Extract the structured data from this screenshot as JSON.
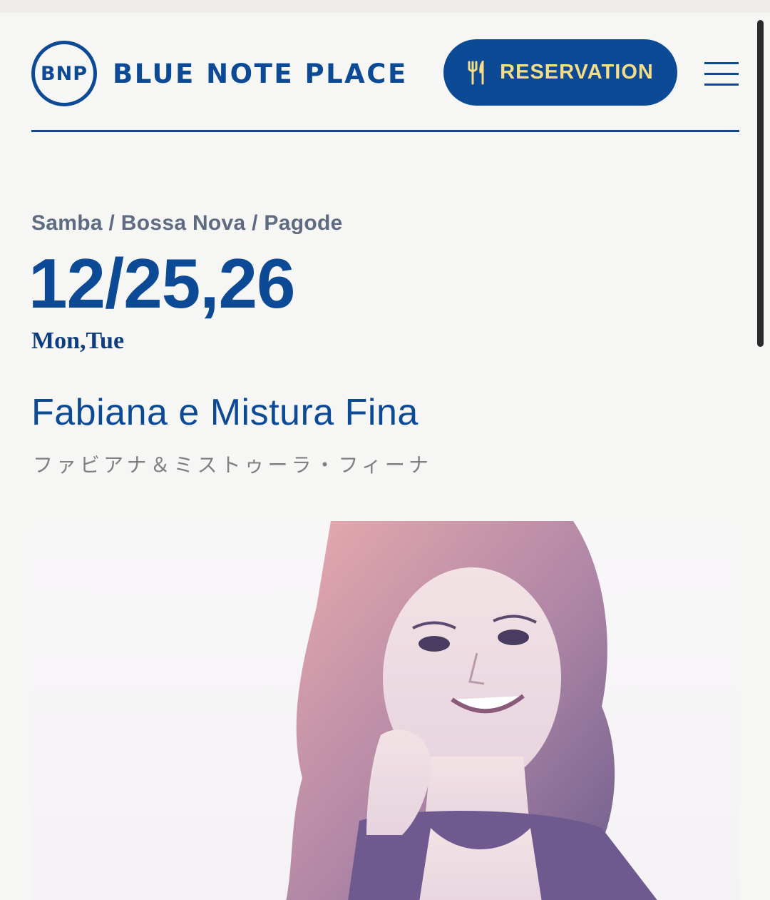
{
  "header": {
    "logo_mark": "BNP",
    "logo_text": "BLUE NOTE PLACE",
    "reservation_label": "RESERVATION",
    "reservation_icon": "fork-knife-icon",
    "menu_icon": "hamburger-menu-icon"
  },
  "event": {
    "genre": "Samba / Bossa Nova / Pagode",
    "date": "12/25,26",
    "days": "Mon,Tue",
    "artist": "Fabiana e Mistura Fina",
    "artist_jp": "ファビアナ＆ミストゥーラ・フィーナ"
  },
  "colors": {
    "brand_blue": "#0d4a96",
    "button_text": "#f4dd86",
    "genre_gray": "#5e6b80"
  }
}
